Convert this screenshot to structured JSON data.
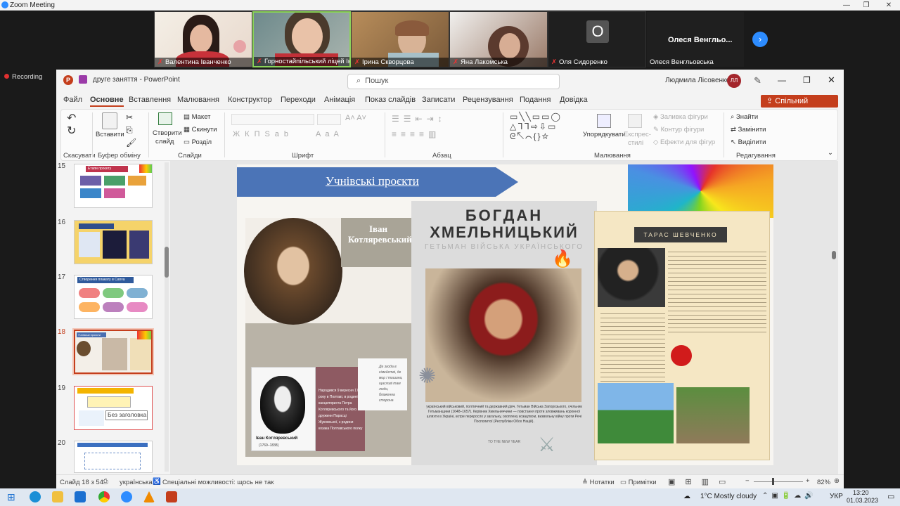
{
  "zoom": {
    "title": "Zoom Meeting",
    "recording": "Recording"
  },
  "participants": [
    {
      "name": "Валентина Іванченко"
    },
    {
      "name": "Горностайпільський ліцей Іваніі..."
    },
    {
      "name": "Ірина Скворцова"
    },
    {
      "name": "Яна Лакомська"
    },
    {
      "name": "Оля Сидоренко",
      "initial": "O"
    },
    {
      "name": "Олеся Венгльовська",
      "display": "Олеся  Венгльо..."
    }
  ],
  "ppt": {
    "filename": "друге заняття - PowerPoint",
    "search_placeholder": "Пошук",
    "user": "Людмила Лісовенко",
    "user_initials": "ЛЛ",
    "share": "Спільний доступ",
    "tabs": [
      "Файл",
      "Основне",
      "Вставлення",
      "Малювання",
      "Конструктор",
      "Переходи",
      "Анімація",
      "Показ слайдів",
      "Записати",
      "Рецензування",
      "Подання",
      "Довідка"
    ],
    "ribbon": {
      "undo": "Скасувати",
      "clipboard": "Буфер обміну",
      "paste": "Вставити",
      "new_slide": "Створити",
      "new_slide2": "слайд",
      "layout": "Макет",
      "reset": "Скинути",
      "section": "Розділ",
      "slides": "Слайди",
      "font": "Шрифт",
      "paragraph": "Абзац",
      "arrange": "Упорядкувати",
      "quick_styles": "Експрес-",
      "quick_styles2": "стилі",
      "fill": "Заливка фігури",
      "outline": "Контур фігури",
      "effects": "Ефекти для фігур",
      "drawing": "Малювання",
      "find": "Знайти",
      "replace": "Замінити",
      "select": "Виділити",
      "editing": "Редагування"
    },
    "thumbnails": [
      {
        "num": "15",
        "title": "Етапи проєкту"
      },
      {
        "num": "16",
        "title": ""
      },
      {
        "num": "17",
        "title": "Створення плакату в Canva"
      },
      {
        "num": "18",
        "title": "Учнівські проєкти"
      },
      {
        "num": "19",
        "title": "",
        "tooltip": "Без заголовка"
      },
      {
        "num": "20",
        "title": ""
      }
    ],
    "slide": {
      "banner": "Учнівські проєкти",
      "kot_name": "Іван Котляревський",
      "kot_caption": "Іван Котляревський",
      "kot_dates": "(1769–1838)",
      "kot_born": "Народився 9 вересня 1769 року в Полтаві, в родині канцеляриста Петра Котляревського та його дружини Парасці Жуковської, з родини козака Полтавського полку",
      "kot_quote": "Де згода в сімействі, де мир і тишина, щасливі там люди, блаженна сторона",
      "khm_title1": "БОГДАН",
      "khm_title2": "ХМЕЛЬНИЦЬКИЙ",
      "khm_sub": "ГЕТЬМАН ВІЙСЬКА УКРАЇНСЬКОГО",
      "khm_text": "український військовий, політичний та державний діяч. Гетьман Війська Запорозького, очільник Гетьманщини (1648–1657). Керівник Хмельниччини — повстання проти зловживань коронної шляхти в Україні, котре переросло у загальну, охоплену козацтвом, визвольну війну проти Речі Посполитої (Республіки Обох Націй).",
      "khm_footer": "TO THE NEW YEAR",
      "shev_title": "ТАРАС ШЕВЧЕНКО"
    }
  },
  "status": {
    "slide": "Слайд 18 з 54",
    "lang": "українська",
    "access": "Спеціальні можливості: щось не так",
    "notes": "Нотатки",
    "comments": "Примітки",
    "zoom": "82%"
  },
  "taskbar": {
    "weather": "1°C  Mostly cloudy",
    "lang": "УКР",
    "time": "13:20",
    "date": "01.03.2023"
  }
}
